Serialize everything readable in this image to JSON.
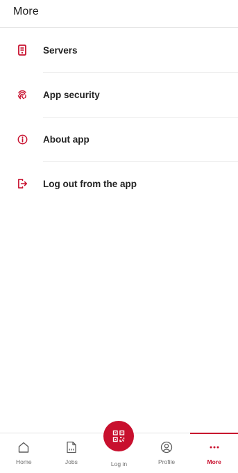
{
  "header": {
    "title": "More"
  },
  "menu": {
    "items": [
      {
        "label": "Servers",
        "icon": "server-icon"
      },
      {
        "label": "App security",
        "icon": "fingerprint-icon"
      },
      {
        "label": "About app",
        "icon": "info-icon"
      },
      {
        "label": "Log out from the app",
        "icon": "logout-icon"
      }
    ]
  },
  "tabbar": {
    "tabs": [
      {
        "label": "Home",
        "icon": "home-icon"
      },
      {
        "label": "Jobs",
        "icon": "document-icon"
      },
      {
        "label": "Log in",
        "icon": "qr-code-icon"
      },
      {
        "label": "Profile",
        "icon": "user-circle-icon"
      },
      {
        "label": "More",
        "icon": "more-dots-icon",
        "active": true
      }
    ]
  },
  "colors": {
    "accent": "#c8102e",
    "text": "#232323",
    "muted": "#6f6f6f",
    "divider": "#ececec"
  }
}
